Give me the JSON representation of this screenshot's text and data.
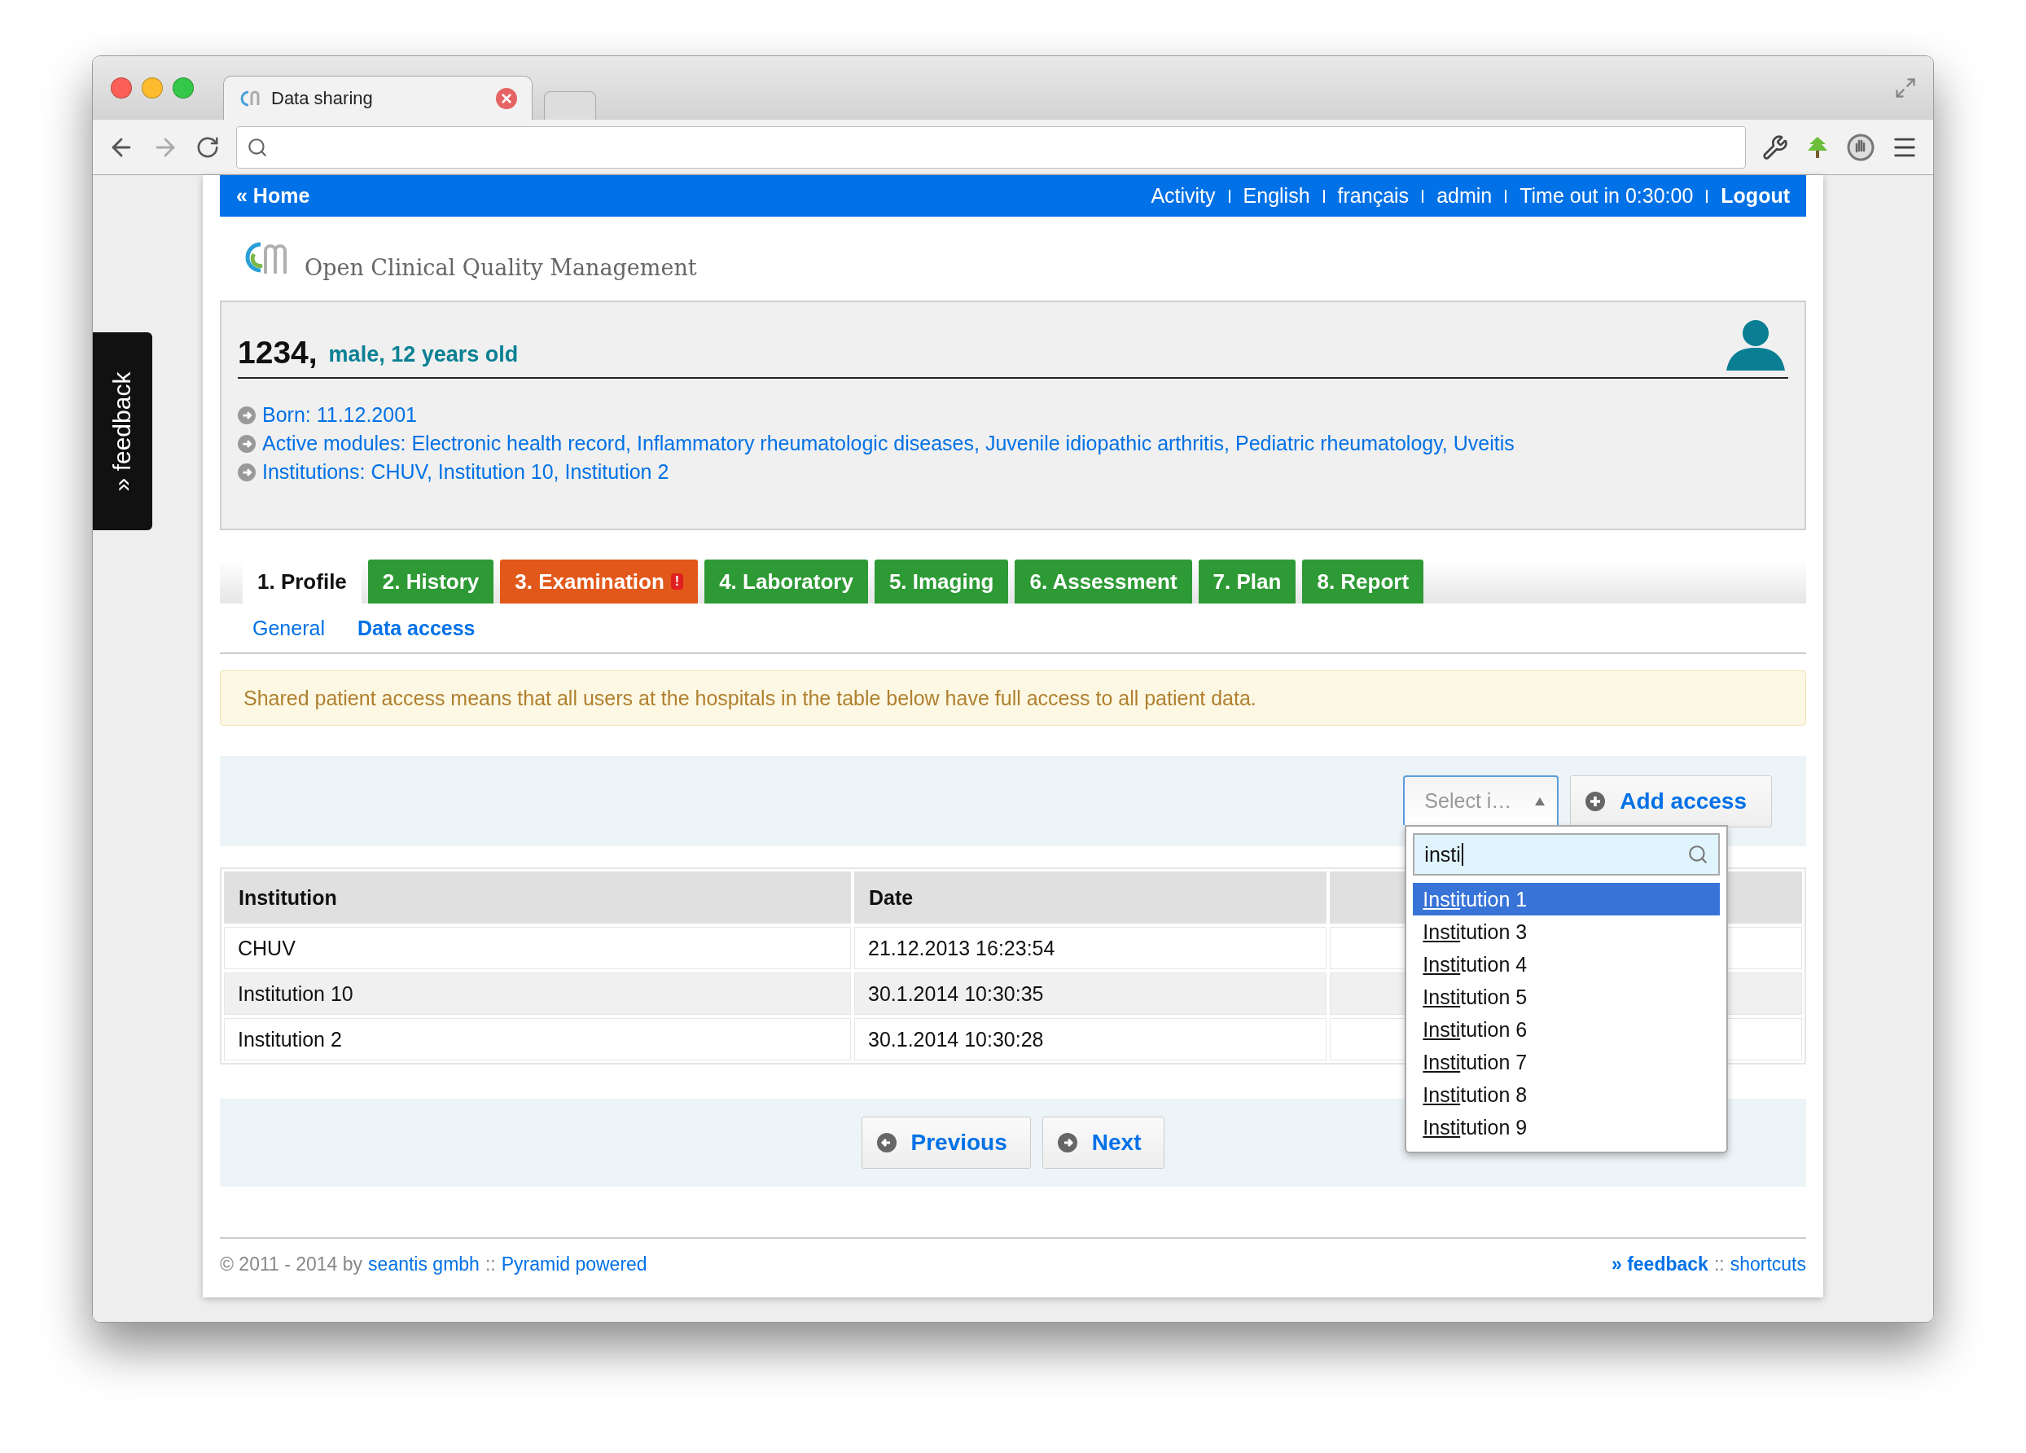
{
  "browser": {
    "tab_title": "Data sharing"
  },
  "nav": {
    "home": "« Home",
    "links": [
      "Activity",
      "English",
      "français",
      "admin"
    ],
    "timeout": "Time out in 0:30:00",
    "logout": "Logout"
  },
  "logo": {
    "text": "Open Clinical Quality Management"
  },
  "feedback_tab": "» feedback",
  "patient": {
    "id": "1234,",
    "summary": "male, 12 years old",
    "details": [
      "Born: 11.12.2001",
      "Active modules: Electronic health record, Inflammatory rheumatologic diseases, Juvenile idiopathic arthritis, Pediatric rheumatology, Uveitis",
      "Institutions: CHUV, Institution 10, Institution 2"
    ]
  },
  "tabs": [
    {
      "label": "1. Profile",
      "selected": true,
      "warning": false
    },
    {
      "label": "2. History",
      "selected": false,
      "warning": false
    },
    {
      "label": "3. Examination",
      "selected": false,
      "warning": true,
      "badge": "!"
    },
    {
      "label": "4. Laboratory",
      "selected": false,
      "warning": false
    },
    {
      "label": "5. Imaging",
      "selected": false,
      "warning": false
    },
    {
      "label": "6. Assessment",
      "selected": false,
      "warning": false
    },
    {
      "label": "7. Plan",
      "selected": false,
      "warning": false
    },
    {
      "label": "8. Report",
      "selected": false,
      "warning": false
    }
  ],
  "subtabs": [
    {
      "label": "General",
      "selected": false
    },
    {
      "label": "Data access",
      "selected": true
    }
  ],
  "notice": "Shared patient access means that all users at the hospitals in the table below have full access to all patient data.",
  "access_form": {
    "select_label": "Select i…",
    "button": "Add access",
    "dropdown": {
      "search": "insti",
      "options": [
        {
          "label": "Institution 1",
          "selected": true
        },
        {
          "label": "Institution 3",
          "selected": false
        },
        {
          "label": "Institution 4",
          "selected": false
        },
        {
          "label": "Institution 5",
          "selected": false
        },
        {
          "label": "Institution 6",
          "selected": false
        },
        {
          "label": "Institution 7",
          "selected": false
        },
        {
          "label": "Institution 8",
          "selected": false
        },
        {
          "label": "Institution 9",
          "selected": false
        }
      ]
    }
  },
  "table": {
    "columns": [
      "Institution",
      "Date"
    ],
    "rows": [
      [
        "CHUV",
        "21.12.2013 16:23:54"
      ],
      [
        "Institution 10",
        "30.1.2014 10:30:35"
      ],
      [
        "Institution 2",
        "30.1.2014 10:30:28"
      ]
    ]
  },
  "pager": {
    "previous": "Previous",
    "next": "Next"
  },
  "footer": {
    "left": [
      {
        "text": "© 2011 - 2014 by",
        "link": false
      },
      {
        "text": "seantis gmbh",
        "link": true
      },
      {
        "text": "::",
        "link": false
      },
      {
        "text": "Pyramid powered",
        "link": true
      }
    ],
    "right": [
      {
        "text": "» feedback",
        "link": true,
        "bold": true
      },
      {
        "text": "::",
        "link": false
      },
      {
        "text": "shortcuts",
        "link": true
      }
    ]
  }
}
